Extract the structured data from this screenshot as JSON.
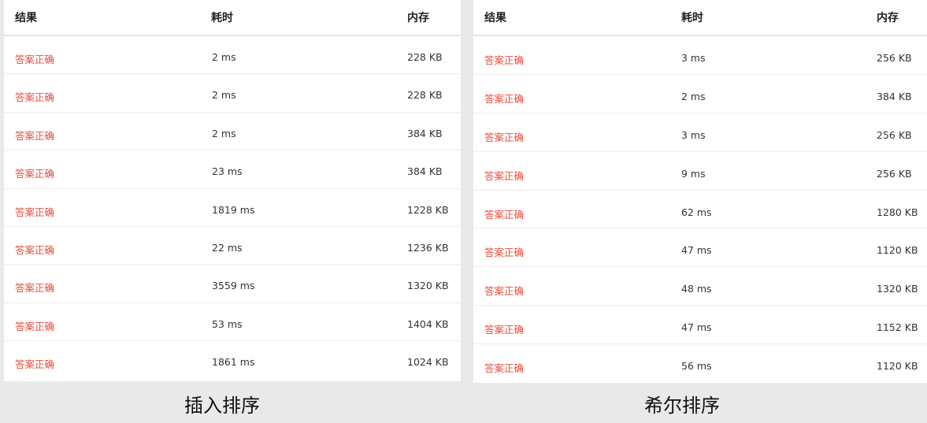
{
  "left": {
    "caption": "插入排序",
    "headers": {
      "result": "结果",
      "time": "耗时",
      "memory": "内存"
    },
    "rows": [
      {
        "result": "答案正确",
        "time": "2 ms",
        "memory": "228 KB"
      },
      {
        "result": "答案正确",
        "time": "2 ms",
        "memory": "228 KB"
      },
      {
        "result": "答案正确",
        "time": "2 ms",
        "memory": "384 KB"
      },
      {
        "result": "答案正确",
        "time": "23 ms",
        "memory": "384 KB"
      },
      {
        "result": "答案正确",
        "time": "1819 ms",
        "memory": "1228 KB"
      },
      {
        "result": "答案正确",
        "time": "22 ms",
        "memory": "1236 KB"
      },
      {
        "result": "答案正确",
        "time": "3559 ms",
        "memory": "1320 KB"
      },
      {
        "result": "答案正确",
        "time": "53 ms",
        "memory": "1404 KB"
      },
      {
        "result": "答案正确",
        "time": "1861 ms",
        "memory": "1024 KB"
      }
    ]
  },
  "right": {
    "caption": "希尔排序",
    "headers": {
      "result": "结果",
      "time": "耗时",
      "memory": "内存"
    },
    "rows": [
      {
        "result": "答案正确",
        "time": "3 ms",
        "memory": "256 KB"
      },
      {
        "result": "答案正确",
        "time": "2 ms",
        "memory": "384 KB"
      },
      {
        "result": "答案正确",
        "time": "3 ms",
        "memory": "256 KB"
      },
      {
        "result": "答案正确",
        "time": "9 ms",
        "memory": "256 KB"
      },
      {
        "result": "答案正确",
        "time": "62 ms",
        "memory": "1280 KB"
      },
      {
        "result": "答案正确",
        "time": "47 ms",
        "memory": "1120 KB"
      },
      {
        "result": "答案正确",
        "time": "48 ms",
        "memory": "1320 KB"
      },
      {
        "result": "答案正确",
        "time": "47 ms",
        "memory": "1152 KB"
      },
      {
        "result": "答案正确",
        "time": "56 ms",
        "memory": "1120 KB"
      }
    ]
  },
  "colors": {
    "result_text": "#e74c3c",
    "background": "#e9e9e9",
    "panel": "#ffffff"
  }
}
